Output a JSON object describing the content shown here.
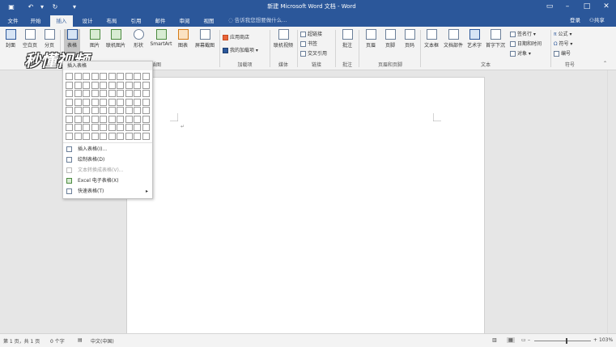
{
  "titlebar": {
    "title": "新建 Microsoft Word 文档 - Word",
    "qa_icons": [
      "save-icon",
      "undo-icon",
      "redo-icon",
      "customize-icon"
    ],
    "window_controls": [
      "ribbon-options-icon",
      "minimize-icon",
      "maximize-icon",
      "close-icon"
    ]
  },
  "tabs": [
    {
      "label": "文件",
      "active": false
    },
    {
      "label": "开始",
      "active": false
    },
    {
      "label": "插入",
      "active": true
    },
    {
      "label": "设计",
      "active": false
    },
    {
      "label": "布局",
      "active": false
    },
    {
      "label": "引用",
      "active": false
    },
    {
      "label": "邮件",
      "active": false
    },
    {
      "label": "审阅",
      "active": false
    },
    {
      "label": "视图",
      "active": false
    }
  ],
  "tellme": "告诉我您想要做什么...",
  "login": "登录",
  "share": "共享",
  "watermark": "秒懂视频",
  "ribbon": {
    "buttons": {
      "cover": "封面",
      "blank_page": "空白页",
      "page_break": "分页",
      "table": "表格",
      "picture": "图片",
      "online_picture": "联机图片",
      "shapes": "形状",
      "smartart": "SmartArt",
      "chart": "图表",
      "screenshot": "屏幕截图",
      "store": "应用商店",
      "my_addins": "我的加载项",
      "online_video": "联机视频",
      "link": "超链接",
      "bookmark": "书签",
      "crossref": "交叉引用",
      "comment": "批注",
      "header": "页眉",
      "footer": "页脚",
      "page_number": "页码",
      "textbox": "文本框",
      "quickparts": "文档部件",
      "wordart": "艺术字",
      "dropcap": "首字下沉",
      "signature": "签名行",
      "datetime": "日期和时间",
      "object": "对象",
      "equation": "公式",
      "symbol": "符号",
      "number": "编号"
    },
    "groups": {
      "pages": "页面",
      "illustrations": "插图",
      "addins": "加载项",
      "media": "媒体",
      "links": "链接",
      "comments": "批注",
      "header_footer": "页眉和页脚",
      "text": "文本",
      "symbols": "符号"
    }
  },
  "table_menu": {
    "header": "插入表格",
    "rows": 8,
    "cols": 10,
    "items": [
      {
        "label": "插入表格(I)...",
        "icon": "insert-table-icon",
        "disabled": false
      },
      {
        "label": "绘制表格(D)",
        "icon": "draw-table-icon",
        "disabled": false
      },
      {
        "label": "文本转换成表格(V)...",
        "icon": "text-to-table-icon",
        "disabled": true
      },
      {
        "label": "Excel 电子表格(X)",
        "icon": "excel-icon",
        "disabled": false
      },
      {
        "label": "快速表格(T)",
        "icon": "quick-table-icon",
        "disabled": false,
        "submenu": true
      }
    ]
  },
  "status": {
    "page": "第 1 页，共 1 页",
    "words": "0 个字",
    "language": "中文(中国)",
    "zoom": "103%",
    "zoom_level": 0.55
  },
  "colors": {
    "accent": "#2b579a",
    "ribbon_bg": "#f3f3f3",
    "workspace": "#e6e6e6"
  }
}
